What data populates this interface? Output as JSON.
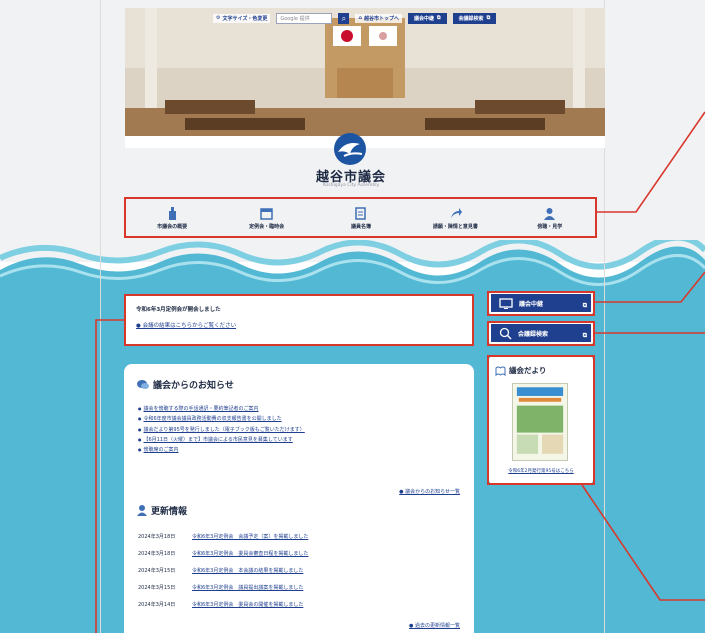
{
  "header": {
    "link_font": "文字サイズ・色変更",
    "search_placeholder": "Google 提供",
    "link_top": "越谷市トップへ",
    "btn_live": "議会中継",
    "btn_minutes": "会議録検索"
  },
  "site": {
    "title": "越谷市議会",
    "subtitle": "Koshigaya City Assembly"
  },
  "nav": [
    {
      "label": "市議会の概要",
      "icon": "building-icon"
    },
    {
      "label": "定例会・臨時会",
      "icon": "calendar-icon"
    },
    {
      "label": "議員名簿",
      "icon": "document-icon"
    },
    {
      "label": "請願・陳情と意見書",
      "icon": "share-icon"
    },
    {
      "label": "傍聴・見学",
      "icon": "person-icon"
    }
  ],
  "notice": {
    "title": "令和6年3月定例会が開会しました",
    "link": "会議の結果はこちらからご覧ください"
  },
  "announcements": {
    "title": "議会からのお知らせ",
    "items": [
      "議会を傍聴する際の手話通訳・要約筆記者のご案内",
      "令和6年度市議会議員政務活動費の収支報告書を公開しました",
      "議会だより第95号を発行しました（電子ブック版もご覧いただけます）",
      "【6月11日（火曜）まで】市議会による市民意見を募集しています",
      "傍聴席のご案内"
    ],
    "more": "議会からのお知らせ一覧"
  },
  "updates": {
    "title": "更新情報",
    "rows": [
      {
        "date": "2024年3月18日",
        "text": "令和6年3月定例会　会議予定（案）を掲載しました"
      },
      {
        "date": "2024年3月18日",
        "text": "令和6年3月定例会　委員会審査日程を掲載しました"
      },
      {
        "date": "2024年3月15日",
        "text": "令和6年3月定例会　本会議の結果を掲載しました"
      },
      {
        "date": "2024年3月15日",
        "text": "令和6年3月定例会　議員提出議案を掲載しました"
      },
      {
        "date": "2024年3月14日",
        "text": "令和6年3月定例会　委員会の開催を掲載しました"
      }
    ],
    "more": "過去の更新情報一覧"
  },
  "side": {
    "live": "議会中継",
    "minutes": "会議録検索",
    "dayori_title": "議会だより",
    "dayori_link": "令和6年2月発行第95号はこちら"
  },
  "colors": {
    "accent": "#1f3f8f",
    "sea": "#53b8d3",
    "callout": "#d8382c"
  }
}
